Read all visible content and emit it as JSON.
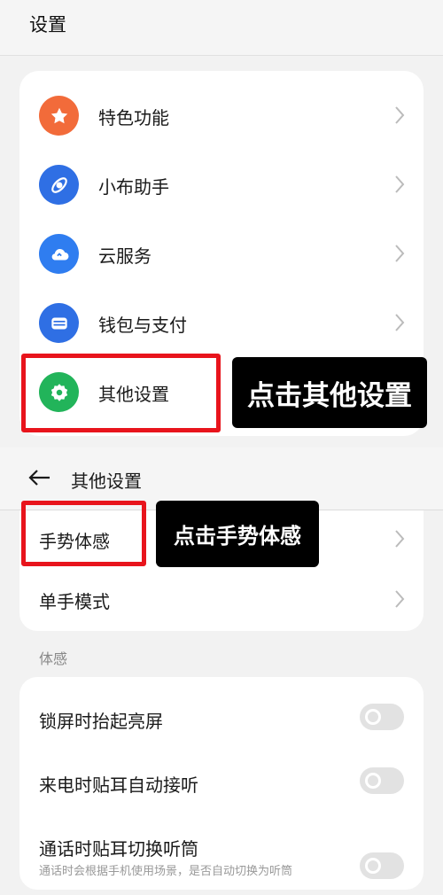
{
  "header": {
    "title": "设置"
  },
  "main_list": {
    "items": [
      {
        "label": "特色功能",
        "icon": "star-icon",
        "color": "#f26b3a"
      },
      {
        "label": "小布助手",
        "icon": "assistant-icon",
        "color": "#2f6fe4"
      },
      {
        "label": "云服务",
        "icon": "cloud-icon",
        "color": "#2f7df0"
      },
      {
        "label": "钱包与支付",
        "icon": "wallet-icon",
        "color": "#2f6fe4"
      },
      {
        "label": "其他设置",
        "icon": "gear-icon",
        "color": "#22b45a"
      }
    ]
  },
  "callouts": {
    "other_settings": "点击其他设置",
    "gesture": "点击手势体感"
  },
  "sub_page": {
    "title": "其他设置",
    "items": [
      {
        "label": "手势体感"
      },
      {
        "label": "单手模式"
      }
    ]
  },
  "motion_section": {
    "label": "体感",
    "toggles": [
      {
        "label": "锁屏时抬起亮屏",
        "on": false
      },
      {
        "label": "来电时贴耳自动接听",
        "on": false
      },
      {
        "label": "通话时贴耳切换听筒",
        "on": false
      }
    ],
    "partial_description": "通话时会根据手机使用场景，是否自动切换为听筒"
  },
  "colors": {
    "highlight": "#e8141c",
    "callout_bg": "#000000"
  }
}
